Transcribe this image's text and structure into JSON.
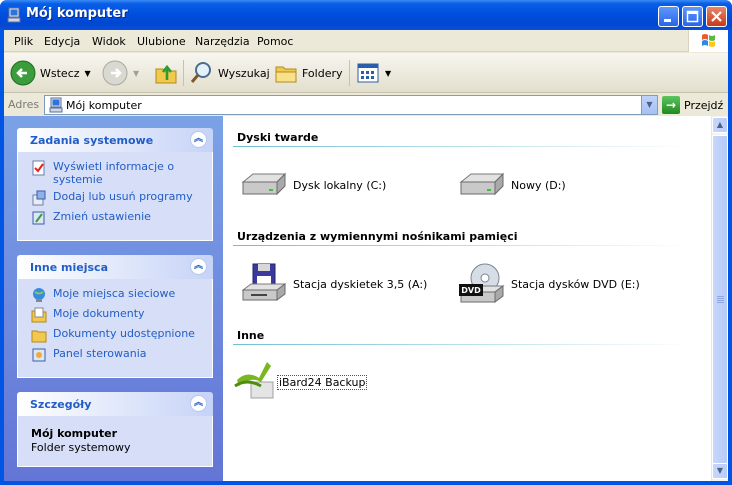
{
  "window": {
    "title": "Mój komputer"
  },
  "menu": [
    "Plik",
    "Edycja",
    "Widok",
    "Ulubione",
    "Narzędzia",
    "Pomoc"
  ],
  "toolbar": {
    "back_label": "Wstecz",
    "search_label": "Wyszukaj",
    "folders_label": "Foldery"
  },
  "address": {
    "label": "Adres",
    "value": "Mój komputer",
    "go_label": "Przejdź"
  },
  "left_panels": {
    "system_tasks": {
      "title": "Zadania systemowe",
      "items": [
        "Wyświetl informacje o systemie",
        "Dodaj lub usuń programy",
        "Zmień ustawienie"
      ]
    },
    "other_places": {
      "title": "Inne miejsca",
      "items": [
        "Moje miejsca sieciowe",
        "Moje dokumenty",
        "Dokumenty udostępnione",
        "Panel sterowania"
      ]
    },
    "details": {
      "title": "Szczegóły",
      "name": "Mój komputer",
      "type": "Folder systemowy"
    }
  },
  "groups": {
    "hard_disks": {
      "title": "Dyski twarde",
      "items": [
        "Dysk lokalny (C:)",
        "Nowy (D:)"
      ]
    },
    "removable": {
      "title": "Urządzenia z wymiennymi nośnikami pamięci",
      "items": [
        "Stacja dyskietek 3,5 (A:)",
        "Stacja dysków DVD (E:)"
      ]
    },
    "other": {
      "title": "Inne",
      "items": [
        "iBard24 Backup"
      ]
    }
  },
  "dvd_badge": "DVD",
  "colors": {
    "title_bar": "#0050e0",
    "task_link": "#215dc6",
    "left_pane": "#6f8ddf",
    "group_line": "#70bfd4"
  }
}
